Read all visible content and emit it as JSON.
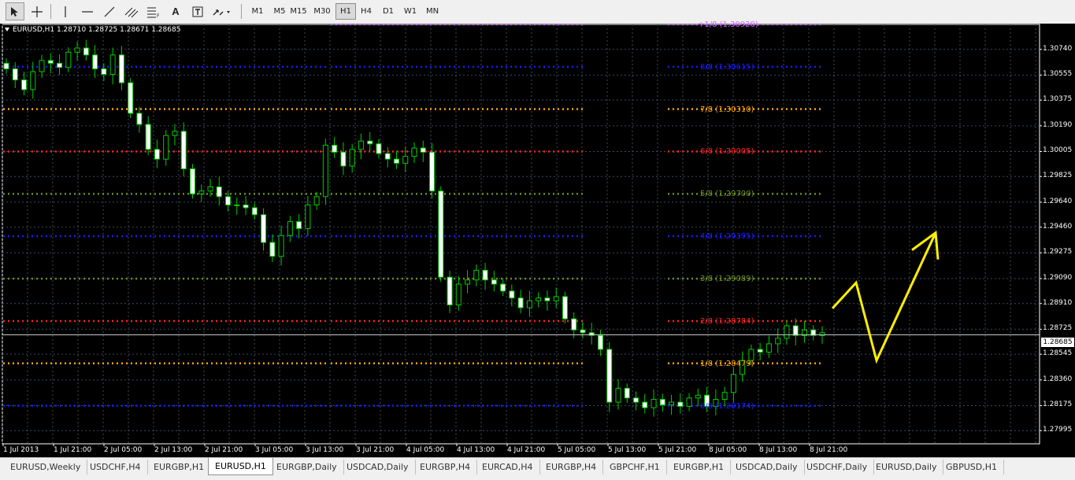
{
  "toolbar": {
    "tools": [
      {
        "name": "cursor-icon"
      },
      {
        "name": "crosshair-icon"
      },
      {
        "name": "vertical-line-icon"
      },
      {
        "name": "horizontal-line-icon"
      },
      {
        "name": "trendline-icon"
      },
      {
        "name": "equidistant-channel-icon"
      },
      {
        "name": "fibonacci-icon"
      },
      {
        "name": "text-icon"
      },
      {
        "name": "text-label-icon"
      },
      {
        "name": "arrows-icon"
      }
    ],
    "text_tool_label": "A",
    "timeframes": [
      "M1",
      "M5",
      "M15",
      "M30",
      "H1",
      "H4",
      "D1",
      "W1",
      "MN"
    ],
    "active_timeframe": "H1"
  },
  "chart": {
    "header": "EURUSD,H1  1.28710 1.28725 1.28671 1.28685",
    "current_price": "1.28685",
    "price_ticks": [
      "1.30740",
      "1.30555",
      "1.30375",
      "1.30190",
      "1.30005",
      "1.29825",
      "1.29640",
      "1.29460",
      "1.29275",
      "1.29090",
      "1.28910",
      "1.28725",
      "1.28545",
      "1.28360",
      "1.28175",
      "1.27995"
    ],
    "time_ticks": [
      "1 Jul 2013",
      "1 Jul 21:00",
      "2 Jul 05:00",
      "2 Jul 13:00",
      "2 Jul 21:00",
      "3 Jul 05:00",
      "3 Jul 13:00",
      "3 Jul 21:00",
      "4 Jul 05:00",
      "4 Jul 13:00",
      "4 Jul 21:00",
      "5 Jul 05:00",
      "5 Jul 13:00",
      "5 Jul 21:00",
      "8 Jul 05:00",
      "8 Jul 13:00",
      "8 Jul 21:00"
    ],
    "levels": [
      {
        "label": "+1/8 (1.30920)",
        "color": "#cc66ff"
      },
      {
        "label": "8/8 (1.30615)",
        "color": "#1a1aff"
      },
      {
        "label": "7/8 (1.30310)",
        "color": "#ffa500"
      },
      {
        "label": "6/8 (1.30005)",
        "color": "#ff2020"
      },
      {
        "label": "5/8 (1.29700)",
        "color": "#6b8e23"
      },
      {
        "label": "4/8 (1.29395)",
        "color": "#1a1aff"
      },
      {
        "label": "3/8 (1.29089)",
        "color": "#6b8e23"
      },
      {
        "label": "2/8 (1.28784)",
        "color": "#ff2020"
      },
      {
        "label": "1/8 (1.28479)",
        "color": "#ffa500"
      },
      {
        "label": "0/8 (1.28174)",
        "color": "#1a1aff"
      }
    ],
    "colors": {
      "background": "#000000",
      "grid": "#3a4a5c",
      "candle_up": "#000000",
      "candle_down": "#ffffff",
      "wick": "#00cc00",
      "drawing_arrow": "#ffee00"
    }
  },
  "tabs": [
    "EURUSD,Weekly",
    "USDCHF,H4",
    "EURGBP,H1",
    "EURUSD,H1",
    "EURGBP,Daily",
    "USDCAD,Daily",
    "EURGBP,H4",
    "EURCAD,H4",
    "EURGBP,H4",
    "GBPCHF,H1",
    "EURGBP,H1",
    "USDCAD,Daily",
    "USDCHF,Daily",
    "EURUSD,Daily",
    "GBPUSD,H1"
  ],
  "active_tab": "EURUSD,H1",
  "chart_data": {
    "type": "candlestick",
    "title": "EURUSD,H1",
    "ylim": [
      1.279,
      1.3092
    ],
    "y_ticks": [
      1.3074,
      1.30555,
      1.30375,
      1.3019,
      1.30005,
      1.29825,
      1.2964,
      1.2946,
      1.29275,
      1.2909,
      1.2891,
      1.28725,
      1.28545,
      1.2836,
      1.28175,
      1.27995
    ],
    "x_labels": [
      "1 Jul 2013",
      "1 Jul 21:00",
      "2 Jul 05:00",
      "2 Jul 13:00",
      "2 Jul 21:00",
      "3 Jul 05:00",
      "3 Jul 13:00",
      "3 Jul 21:00",
      "4 Jul 05:00",
      "4 Jul 13:00",
      "4 Jul 21:00",
      "5 Jul 05:00",
      "5 Jul 13:00",
      "5 Jul 21:00",
      "8 Jul 05:00",
      "8 Jul 13:00",
      "8 Jul 21:00"
    ],
    "close_path": [
      1.306,
      1.3052,
      1.3045,
      1.3058,
      1.3066,
      1.3064,
      1.3061,
      1.3072,
      1.3075,
      1.307,
      1.306,
      1.3056,
      1.307,
      1.305,
      1.3028,
      1.302,
      1.3002,
      1.2995,
      1.3012,
      1.3015,
      1.2988,
      1.297,
      1.2972,
      1.2975,
      1.2968,
      1.2962,
      1.2962,
      1.296,
      1.2955,
      1.2935,
      1.2925,
      1.294,
      1.295,
      1.2945,
      1.2962,
      1.2968,
      1.3005,
      1.3,
      1.299,
      1.3002,
      1.3008,
      1.3006,
      1.2999,
      1.2995,
      1.2992,
      1.2997,
      1.3003,
      1.3,
      1.2972,
      1.291,
      1.289,
      1.2905,
      1.2908,
      1.2915,
      1.2908,
      1.2905,
      1.29,
      1.2895,
      1.2888,
      1.2893,
      1.2895,
      1.2893,
      1.2896,
      1.288,
      1.2872,
      1.287,
      1.2868,
      1.2858,
      1.282,
      1.283,
      1.2823,
      1.282,
      1.2816,
      1.2822,
      1.2818,
      1.282,
      1.2817,
      1.2823,
      1.2825,
      1.2817,
      1.2822,
      1.2827,
      1.284,
      1.285,
      1.2858,
      1.2856,
      1.2862,
      1.2866,
      1.2875,
      1.2868,
      1.2872,
      1.2868,
      1.287
    ],
    "annotation": {
      "type": "zigzag-arrow",
      "points": [
        [
          1.28875,
          0
        ],
        [
          1.2906,
          1
        ],
        [
          1.285,
          2
        ],
        [
          1.2942,
          3
        ]
      ]
    }
  }
}
